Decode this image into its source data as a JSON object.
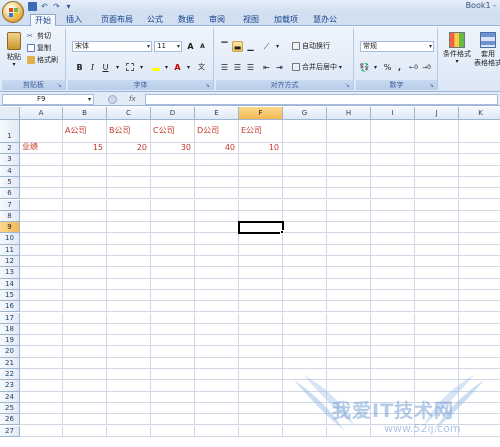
{
  "window": {
    "title": "Book1 -"
  },
  "tabs": [
    {
      "label": "开始",
      "active": true
    },
    {
      "label": "插入"
    },
    {
      "label": "页面布局"
    },
    {
      "label": "公式"
    },
    {
      "label": "数据"
    },
    {
      "label": "审阅"
    },
    {
      "label": "视图"
    },
    {
      "label": "加载项"
    },
    {
      "label": "慧办公"
    }
  ],
  "ribbon": {
    "clipboard": {
      "paste": "粘贴",
      "cut": "剪切",
      "copy": "复制",
      "format_painter": "格式刷",
      "label": "剪贴板"
    },
    "font": {
      "name": "宋体",
      "size": "11",
      "label": "字体",
      "bold": "B",
      "italic": "I",
      "underline": "U",
      "grow": "A",
      "shrink": "A"
    },
    "alignment": {
      "wrap": "自动换行",
      "merge": "合并后居中",
      "label": "对齐方式"
    },
    "number": {
      "format": "常规",
      "percent": "%",
      "comma": ",",
      "label": "数字"
    },
    "styles": {
      "conditional": "条件格式",
      "table": "套用",
      "table2": "表格格式"
    }
  },
  "formula_bar": {
    "name_box": "F9",
    "fx": "fx",
    "content": ""
  },
  "sheet": {
    "columns": [
      "A",
      "B",
      "C",
      "D",
      "E",
      "F",
      "G",
      "H",
      "I",
      "J",
      "K"
    ],
    "selected_column": "F",
    "selected_row": 9,
    "rows": [
      1,
      2,
      3,
      4,
      5,
      6,
      7,
      8,
      9,
      10,
      11,
      12,
      13,
      14,
      15,
      16,
      17,
      18,
      19,
      20,
      21,
      22,
      23,
      24,
      25,
      26,
      27
    ],
    "cells": {
      "B1": "A公司",
      "C1": "B公司",
      "D1": "C公司",
      "E1": "D公司",
      "F1": "E公司",
      "A2": "业绩",
      "B2": "15",
      "C2": "20",
      "D2": "30",
      "E2": "40",
      "F2": "10"
    }
  },
  "watermark": {
    "text": "我爱IT技术网",
    "url": "www.52ij.com"
  },
  "colors": {
    "accent": "#15428b",
    "cell_text": "#c0392b",
    "selected_header": "#f6b855"
  }
}
